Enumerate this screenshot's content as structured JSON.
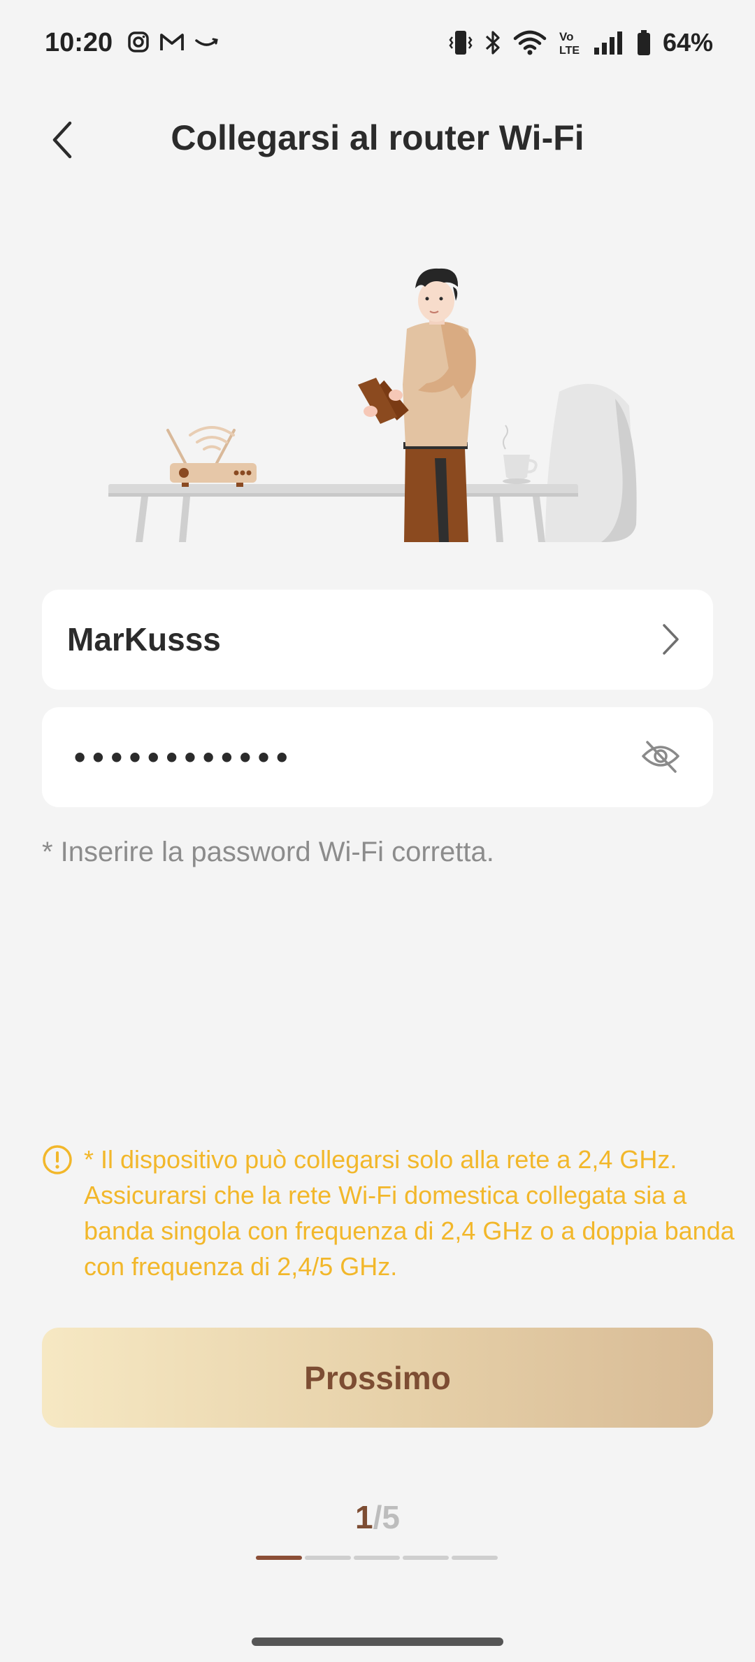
{
  "status_bar": {
    "time": "10:20",
    "battery_percent": "64%",
    "left_icons": [
      "instagram-icon",
      "gmail-icon",
      "amazon-icon"
    ],
    "right_icons": [
      "vibrate-icon",
      "bluetooth-icon",
      "wifi-icon",
      "volte-icon",
      "signal-icon",
      "battery-icon"
    ]
  },
  "header": {
    "title": "Collegarsi al router Wi-Fi",
    "back_icon": "chevron-left-icon"
  },
  "wifi": {
    "ssid": "MarKusss",
    "password_masked": "••••••••••••",
    "password_hint": "* Inserire la password Wi-Fi corretta."
  },
  "warning": {
    "icon": "exclamation-circle-icon",
    "text": "* Il dispositivo può collegarsi solo alla rete a 2,4 GHz. Assicurarsi che la rete Wi-Fi domestica collegata sia a banda singola con frequenza di 2,4 GHz o a doppia banda con frequenza di 2,4/5 GHz."
  },
  "next_button": {
    "label": "Prossimo"
  },
  "pager": {
    "current": "1",
    "separator": "/",
    "total": "5"
  },
  "steps": {
    "total": 5,
    "current": 1
  },
  "colors": {
    "accent_brown": "#7d4d33",
    "warning_yellow": "#f2b72a",
    "button_gradient_start": "#f6e8c3",
    "button_gradient_end": "#d8bb96"
  }
}
